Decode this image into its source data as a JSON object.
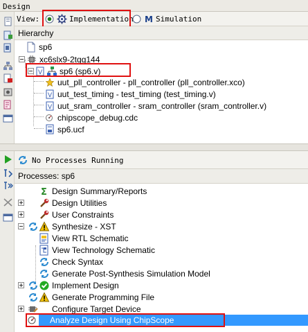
{
  "design_title": "Design",
  "view_bar": {
    "label": "View:",
    "options": [
      {
        "label": "Implementation",
        "selected": true
      },
      {
        "label": "Simulation",
        "selected": false
      }
    ]
  },
  "hierarchy": {
    "title": "Hierarchy",
    "project": "sp6",
    "device": "xc6slx9-2tqg144",
    "top_module": "sp6 (sp6.v)",
    "children": [
      "uut_pll_controller - pll_controller (pll_controller.xco)",
      "uut_test_timing - test_timing (test_timing.v)",
      "uut_sram_controller - sram_controller (sram_controller.v)",
      "chipscope_debug.cdc",
      "sp6.ucf"
    ]
  },
  "status": {
    "text": "No Processes Running"
  },
  "processes": {
    "title": "Processes: sp6",
    "items": [
      {
        "label": "Design Summary/Reports",
        "icon": "sigma-icon"
      },
      {
        "label": "Design Utilities",
        "icon": "tools-icon"
      },
      {
        "label": "User Constraints",
        "icon": "tools-icon"
      },
      {
        "label": "Synthesize - XST",
        "icon": "warning-icon"
      },
      {
        "label": "View RTL Schematic",
        "icon": "schematic-icon"
      },
      {
        "label": "View Technology Schematic",
        "icon": "schematic-icon"
      },
      {
        "label": "Check Syntax",
        "icon": "run-icon"
      },
      {
        "label": "Generate Post-Synthesis Simulation Model",
        "icon": "run-icon"
      },
      {
        "label": "Implement Design",
        "icon": "check-icon"
      },
      {
        "label": "Generate Programming File",
        "icon": "warning-icon"
      },
      {
        "label": "Configure Target Device",
        "icon": "device-icon"
      },
      {
        "label": "Analyze Design Using ChipScope",
        "icon": "chipscope-icon"
      }
    ]
  },
  "colors": {
    "selection": "#3399ff",
    "highlight_box": "#e01010",
    "warning": "#f2c200",
    "ok": "#22aa22"
  }
}
